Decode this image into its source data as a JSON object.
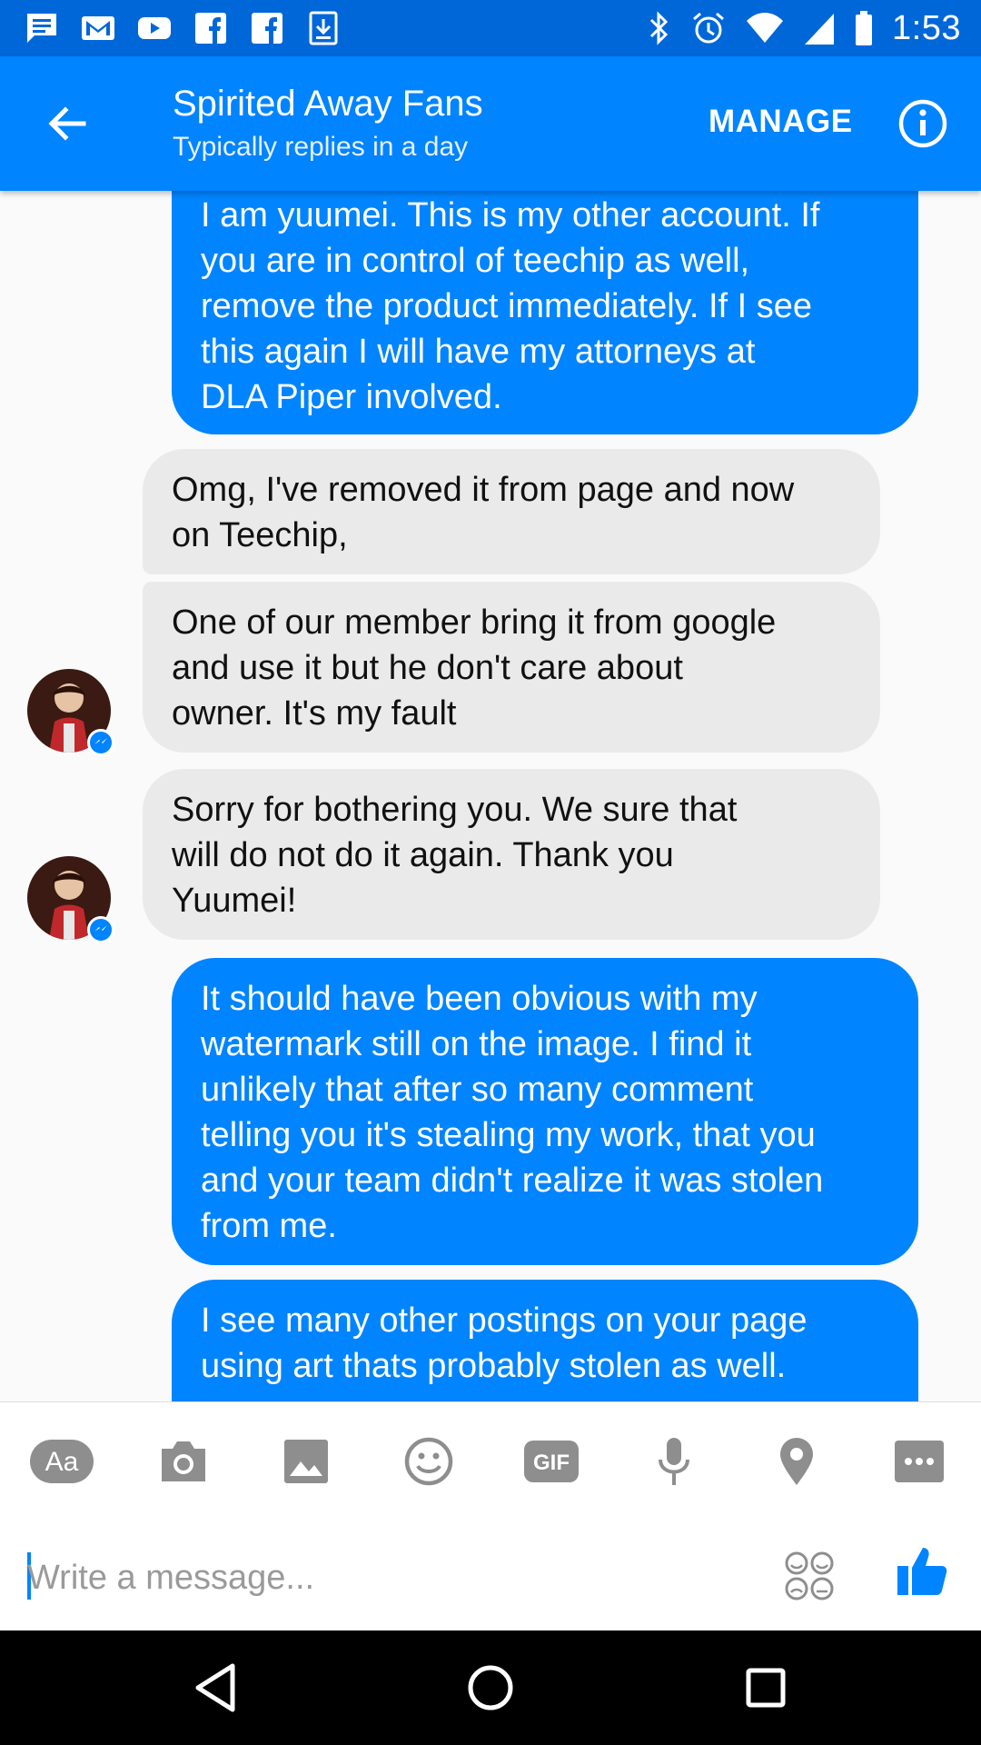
{
  "status_bar": {
    "time": "1:53",
    "notification_icons": [
      "messages-icon",
      "gmail-icon",
      "youtube-icon",
      "facebook-icon",
      "facebook-icon",
      "download-icon"
    ],
    "system_icons": [
      "bluetooth-icon",
      "alarm-icon",
      "wifi-icon",
      "signal-icon",
      "battery-icon"
    ]
  },
  "header": {
    "title": "Spirited Away Fans",
    "subtitle": "Typically replies in a day",
    "manage_label": "MANAGE"
  },
  "messages": [
    {
      "direction": "outgoing",
      "lines": [
        "I am yuumei. This is my other account. If",
        "you are in control of teechip as well,",
        "remove the product immediately. If I see",
        "this again I will have my attorneys at",
        "DLA  Piper involved."
      ]
    },
    {
      "direction": "incoming",
      "lines": [
        "Omg, I've removed it from page and now",
        "on Teechip,"
      ]
    },
    {
      "direction": "incoming",
      "lines": [
        "One of our member bring it from google",
        "and use it but he don't care about",
        "owner. It's my fault"
      ]
    },
    {
      "direction": "incoming",
      "lines": [
        "Sorry for bothering you. We sure that",
        "will do not do it again. Thank you",
        "Yuumei!"
      ]
    },
    {
      "direction": "outgoing",
      "lines": [
        "It should have been obvious with my",
        "watermark still on the image. I find it",
        "unlikely that after so many comment",
        "telling you it's stealing my work, that you",
        "and your team didn't realize it was stolen",
        "from me."
      ]
    },
    {
      "direction": "outgoing",
      "lines": [
        "I see many other postings on your page",
        "using art thats probably stolen as well."
      ]
    }
  ],
  "composer": {
    "text_format_label": "Aa",
    "gif_label": "GIF",
    "placeholder": "Write a message...",
    "tools": [
      "text-format-icon",
      "camera-icon",
      "image-icon",
      "emoji-icon",
      "gif-icon",
      "microphone-icon",
      "location-icon",
      "more-icon"
    ]
  },
  "colors": {
    "status_bar": "#0067d8",
    "app_bar": "#0084ff",
    "outgoing_bubble": "#0084ff",
    "incoming_bubble": "#eaeaea",
    "tool_icon": "#8e8e8e",
    "like": "#0084ff"
  }
}
